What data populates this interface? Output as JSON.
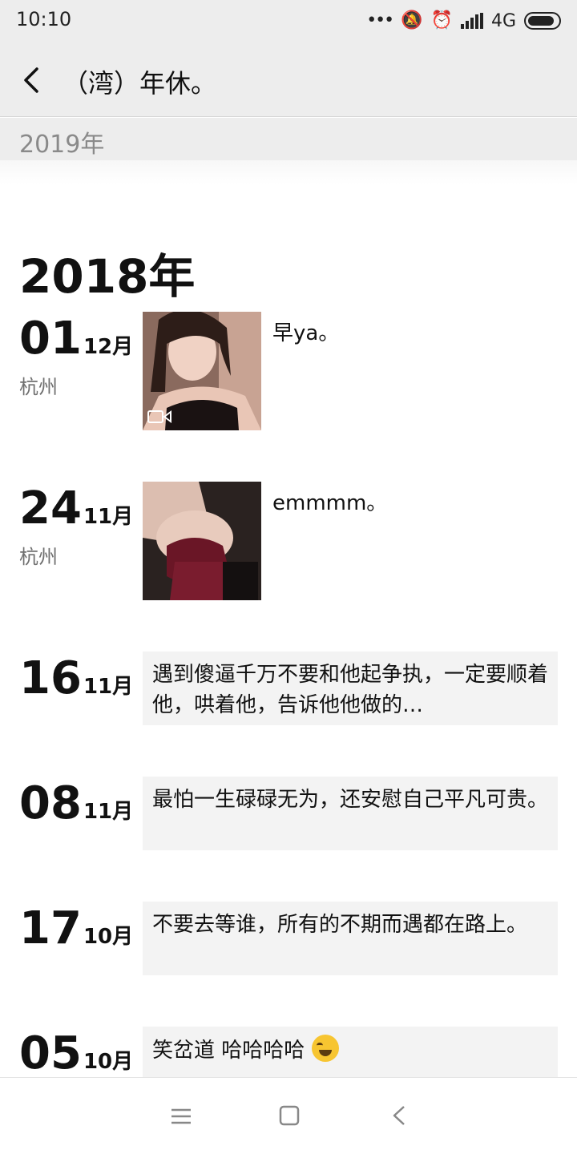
{
  "status_bar": {
    "time": "10:10",
    "dots": "•••",
    "mute_glyph": "🔕",
    "alarm_glyph": "⏰",
    "network": "4G"
  },
  "header": {
    "title": "（湾）年休。",
    "back_icon": "chevron-left-icon"
  },
  "year_strip": {
    "label": "2019年"
  },
  "timeline": {
    "year_heading": "2018年",
    "entries": [
      {
        "day": "01",
        "month": "12月",
        "location": "杭州",
        "caption": "早ya。",
        "media": "video"
      },
      {
        "day": "24",
        "month": "11月",
        "location": "杭州",
        "caption": "emmmm。",
        "media": "photo"
      },
      {
        "day": "16",
        "month": "11月",
        "text": "遇到傻逼千万不要和他起争执，一定要顺着他，哄着他，告诉他他做的…"
      },
      {
        "day": "08",
        "month": "11月",
        "text": "最怕一生碌碌无为，还安慰自己平凡可贵。"
      },
      {
        "day": "17",
        "month": "10月",
        "text": "不要去等谁，所有的不期而遇都在路上。"
      },
      {
        "day": "05",
        "month": "10月",
        "text": "笑岔道 哈哈哈哈",
        "emoji": "laughing-tears-emoji"
      }
    ]
  },
  "nav_bar": {
    "menu_icon": "menu-icon",
    "home_icon": "home-square-icon",
    "back_icon": "back-triangle-icon"
  },
  "colors": {
    "header_bg": "#ededed",
    "bubble_bg": "#f3f3f3",
    "secondary_text": "#8a8a8a"
  }
}
